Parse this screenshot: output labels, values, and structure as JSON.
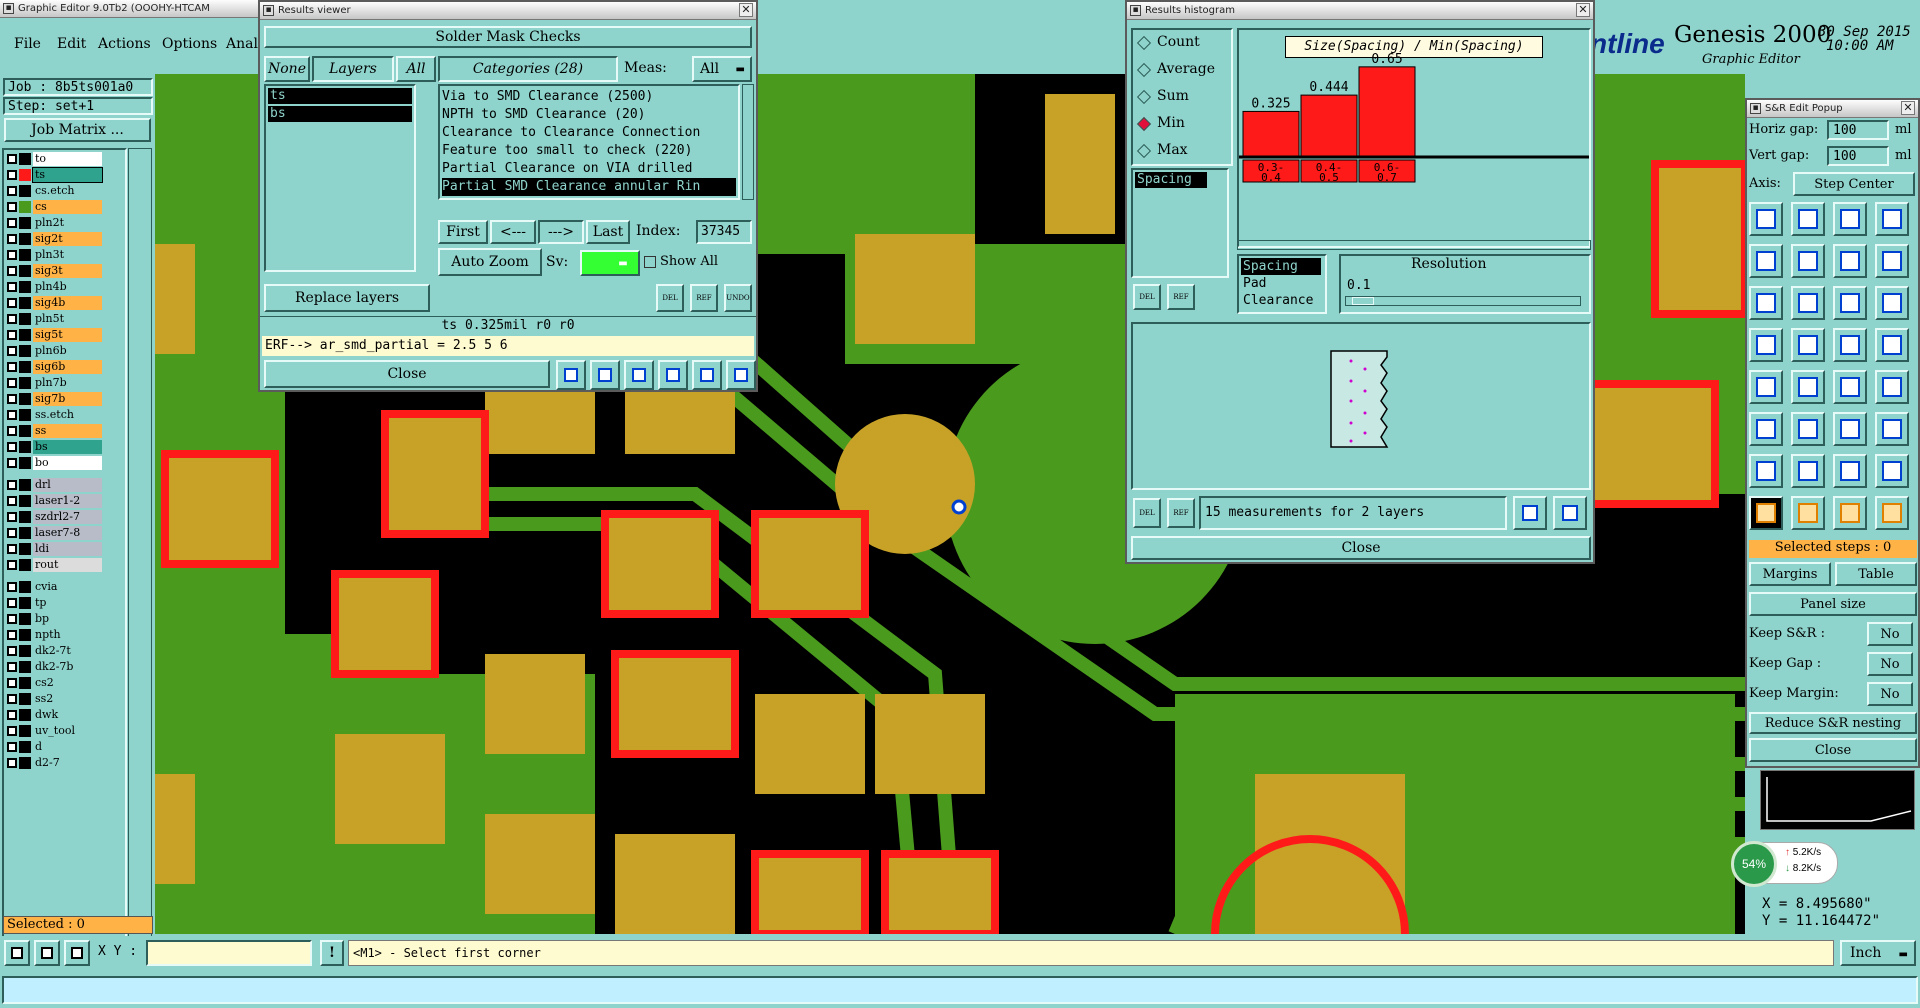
{
  "app": {
    "window_title": "Graphic Editor 9.0Tb2 (OOOHY-HTCAM",
    "brand": "Genesis 2000",
    "brand_logo_text": "ntline",
    "brand_sub": "Graphic Editor",
    "date": "30 Sep 2015",
    "time": "10:00 AM"
  },
  "menu": [
    "File",
    "Edit",
    "Actions",
    "Options",
    "Anal"
  ],
  "job": {
    "job_label": "Job : 8b5ts001a0",
    "step_label": "Step: set+1",
    "matrix_button": "Job Matrix ..."
  },
  "layers": [
    {
      "name": "to",
      "color": "#ffffff",
      "swatch": "#000000"
    },
    {
      "name": "ts",
      "color": "#2fa38e",
      "swatch": "#ff1a1a",
      "active": true
    },
    {
      "name": "cs.etch",
      "color": "#8fd4cc",
      "swatch": "#000000"
    },
    {
      "name": "cs",
      "color": "#ffb347",
      "swatch": "#4a9a1e"
    },
    {
      "name": "pln2t",
      "color": "#8fd4cc",
      "swatch": "#000000"
    },
    {
      "name": "sig2t",
      "color": "#ffb347",
      "swatch": "#000000"
    },
    {
      "name": "pln3t",
      "color": "#8fd4cc",
      "swatch": "#000000"
    },
    {
      "name": "sig3t",
      "color": "#ffb347",
      "swatch": "#000000"
    },
    {
      "name": "pln4b",
      "color": "#8fd4cc",
      "swatch": "#000000"
    },
    {
      "name": "sig4b",
      "color": "#ffb347",
      "swatch": "#000000"
    },
    {
      "name": "pln5t",
      "color": "#8fd4cc",
      "swatch": "#000000"
    },
    {
      "name": "sig5t",
      "color": "#ffb347",
      "swatch": "#000000"
    },
    {
      "name": "pln6b",
      "color": "#8fd4cc",
      "swatch": "#000000"
    },
    {
      "name": "sig6b",
      "color": "#ffb347",
      "swatch": "#000000"
    },
    {
      "name": "pln7b",
      "color": "#8fd4cc",
      "swatch": "#000000"
    },
    {
      "name": "sig7b",
      "color": "#ffb347",
      "swatch": "#000000"
    },
    {
      "name": "ss.etch",
      "color": "#8fd4cc",
      "swatch": "#000000"
    },
    {
      "name": "ss",
      "color": "#ffb347",
      "swatch": "#000000"
    },
    {
      "name": "bs",
      "color": "#2fa38e",
      "swatch": "#000000"
    },
    {
      "name": "bo",
      "color": "#ffffff",
      "swatch": "#000000"
    },
    {
      "name": "drl",
      "color": "#b8bcc8",
      "swatch": "#000000"
    },
    {
      "name": "laser1-2",
      "color": "#b8bcc8",
      "swatch": "#000000"
    },
    {
      "name": "szdrl2-7",
      "color": "#b8bcc8",
      "swatch": "#000000"
    },
    {
      "name": "laser7-8",
      "color": "#b8bcc8",
      "swatch": "#000000"
    },
    {
      "name": "ldi",
      "color": "#b8bcc8",
      "swatch": "#000000"
    },
    {
      "name": "rout",
      "color": "#dcdcdc",
      "swatch": "#000000"
    },
    {
      "name": "cvia",
      "color": "#8fd4cc",
      "swatch": "#000000"
    },
    {
      "name": "tp",
      "color": "#8fd4cc",
      "swatch": "#000000"
    },
    {
      "name": "bp",
      "color": "#8fd4cc",
      "swatch": "#000000"
    },
    {
      "name": "npth",
      "color": "#8fd4cc",
      "swatch": "#000000"
    },
    {
      "name": "dk2-7t",
      "color": "#8fd4cc",
      "swatch": "#000000"
    },
    {
      "name": "dk2-7b",
      "color": "#8fd4cc",
      "swatch": "#000000"
    },
    {
      "name": "cs2",
      "color": "#8fd4cc",
      "swatch": "#000000"
    },
    {
      "name": "ss2",
      "color": "#8fd4cc",
      "swatch": "#000000"
    },
    {
      "name": "dwk",
      "color": "#8fd4cc",
      "swatch": "#000000"
    },
    {
      "name": "uv_tool",
      "color": "#8fd4cc",
      "swatch": "#000000"
    },
    {
      "name": "d",
      "color": "#8fd4cc",
      "swatch": "#000000"
    },
    {
      "name": "d2-7",
      "color": "#8fd4cc",
      "swatch": "#000000"
    }
  ],
  "selected_left": "Selected : 0",
  "results_viewer": {
    "title": "Results viewer",
    "header": "Solder Mask Checks",
    "tab_none": "None",
    "tab_layers": "Layers",
    "tab_all": "All",
    "categories_label": "Categories (28)",
    "meas_label": "Meas:",
    "meas_value": "All",
    "layer_items": [
      "ts",
      "bs"
    ],
    "categories": [
      "Via to SMD Clearance (2500)",
      "NPTH to SMD Clearance (20)",
      "Clearance to Clearance Connection",
      "Feature too small to check (220)",
      "Partial Clearance on VIA drilled",
      "Partial SMD Clearance annular Rin"
    ],
    "first": "First",
    "prev": "<---",
    "next": "--->",
    "last": "Last",
    "index_label": "Index:",
    "index_value": "37345",
    "auto_zoom": "Auto Zoom",
    "sv_label": "Sv:",
    "show_all": "Show All",
    "replace_layers": "Replace layers",
    "status": "ts 0.325mil  r0  r0",
    "erf": "ERF--> ar_smd_partial = 2.5 5 6",
    "close": "Close",
    "del": "DEL",
    "ref": "REF",
    "undo": "UNDO"
  },
  "histogram": {
    "title": "Results histogram",
    "options": [
      "Count",
      "Average",
      "Sum",
      "Min",
      "Max"
    ],
    "selected_option": "Min",
    "chart_title": "Size(Spacing) / Min(Spacing)",
    "selected_list": [
      "Spacing"
    ],
    "list2": [
      "Spacing",
      "Pad",
      "Clearance"
    ],
    "resolution_label": "Resolution",
    "resolution_value": "0.1",
    "measurements": "15 measurements for 2 layers",
    "close": "Close",
    "del": "DEL",
    "ref": "REF"
  },
  "chart_data": {
    "type": "bar",
    "title": "Size(Spacing) / Min(Spacing)",
    "categories": [
      "0.3-0.4",
      "0.4-0.5",
      "0.6-0.7"
    ],
    "values": [
      0.325,
      0.444,
      0.65
    ],
    "value_labels": [
      "0.325",
      "0.444",
      "0.65"
    ],
    "bar_color": "#ff1a1a",
    "ylim": [
      0,
      0.7
    ]
  },
  "sr_popup": {
    "title": "S&R Edit Popup",
    "horiz_label": "Horiz gap:",
    "horiz_value": "100",
    "vert_label": "Vert  gap:",
    "vert_value": "100",
    "unit": "ml",
    "axis_label": "Axis:",
    "axis_value": "Step Center",
    "selected_steps": "Selected steps : 0",
    "margins": "Margins",
    "table": "Table",
    "panel_size": "Panel size",
    "keep_sr_label": "Keep S&R  :",
    "keep_gap_label": "Keep Gap  :",
    "keep_margin_label": "Keep Margin:",
    "no": "No",
    "reduce": "Reduce S&R nesting",
    "close": "Close"
  },
  "network": {
    "percent": "54%",
    "up": "5.2K/s",
    "down": "8.2K/s"
  },
  "coords": {
    "x": "X = 8.495680\"",
    "y": "Y = 11.164472\""
  },
  "bottom": {
    "xy_label": "X Y :",
    "xy_value": "",
    "prompt": "<M1> - Select first corner",
    "unit": "Inch"
  }
}
